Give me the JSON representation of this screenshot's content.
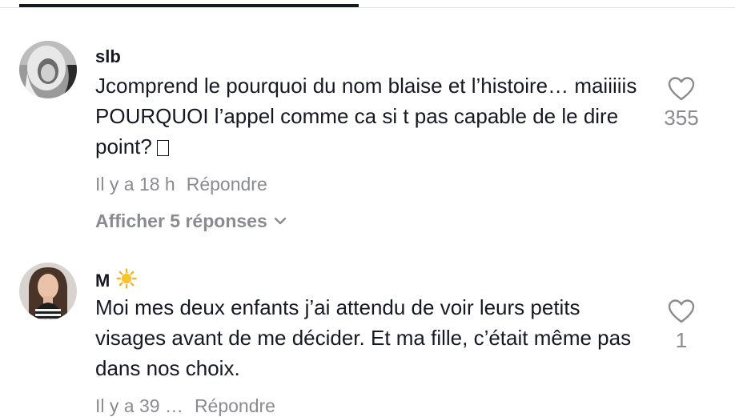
{
  "comments": [
    {
      "username": "slb",
      "text": "Jcomprend le pourquoi du nom blaise et l’histoire… maiiiiis POURQUOI l’appel comme ca si t pas capable de le dire point?",
      "emoji_glyph": "missing-glyph-box",
      "time": "Il y a 18 h",
      "reply_label": "Répondre",
      "view_replies_label": "Afficher 5 réponses",
      "likes": "355",
      "avatar": "avatar-blonde-woman"
    },
    {
      "username": "M",
      "badge": "sun-emoji",
      "text": "Moi mes deux enfants j’ai attendu de voir leurs petits visages avant de me décider. Et ma fille, c’était même pas dans nos choix.",
      "time": "Il y a 39 …",
      "reply_label": "Répondre",
      "likes": "1",
      "avatar": "avatar-brunette-woman"
    }
  ],
  "icons": {
    "like": "heart-outline-icon",
    "expand": "chevron-down-icon"
  },
  "colors": {
    "text_primary": "#161823",
    "text_secondary": "#8a8b91",
    "divider": "#e3e3e4",
    "tab_indicator": "#161823"
  }
}
